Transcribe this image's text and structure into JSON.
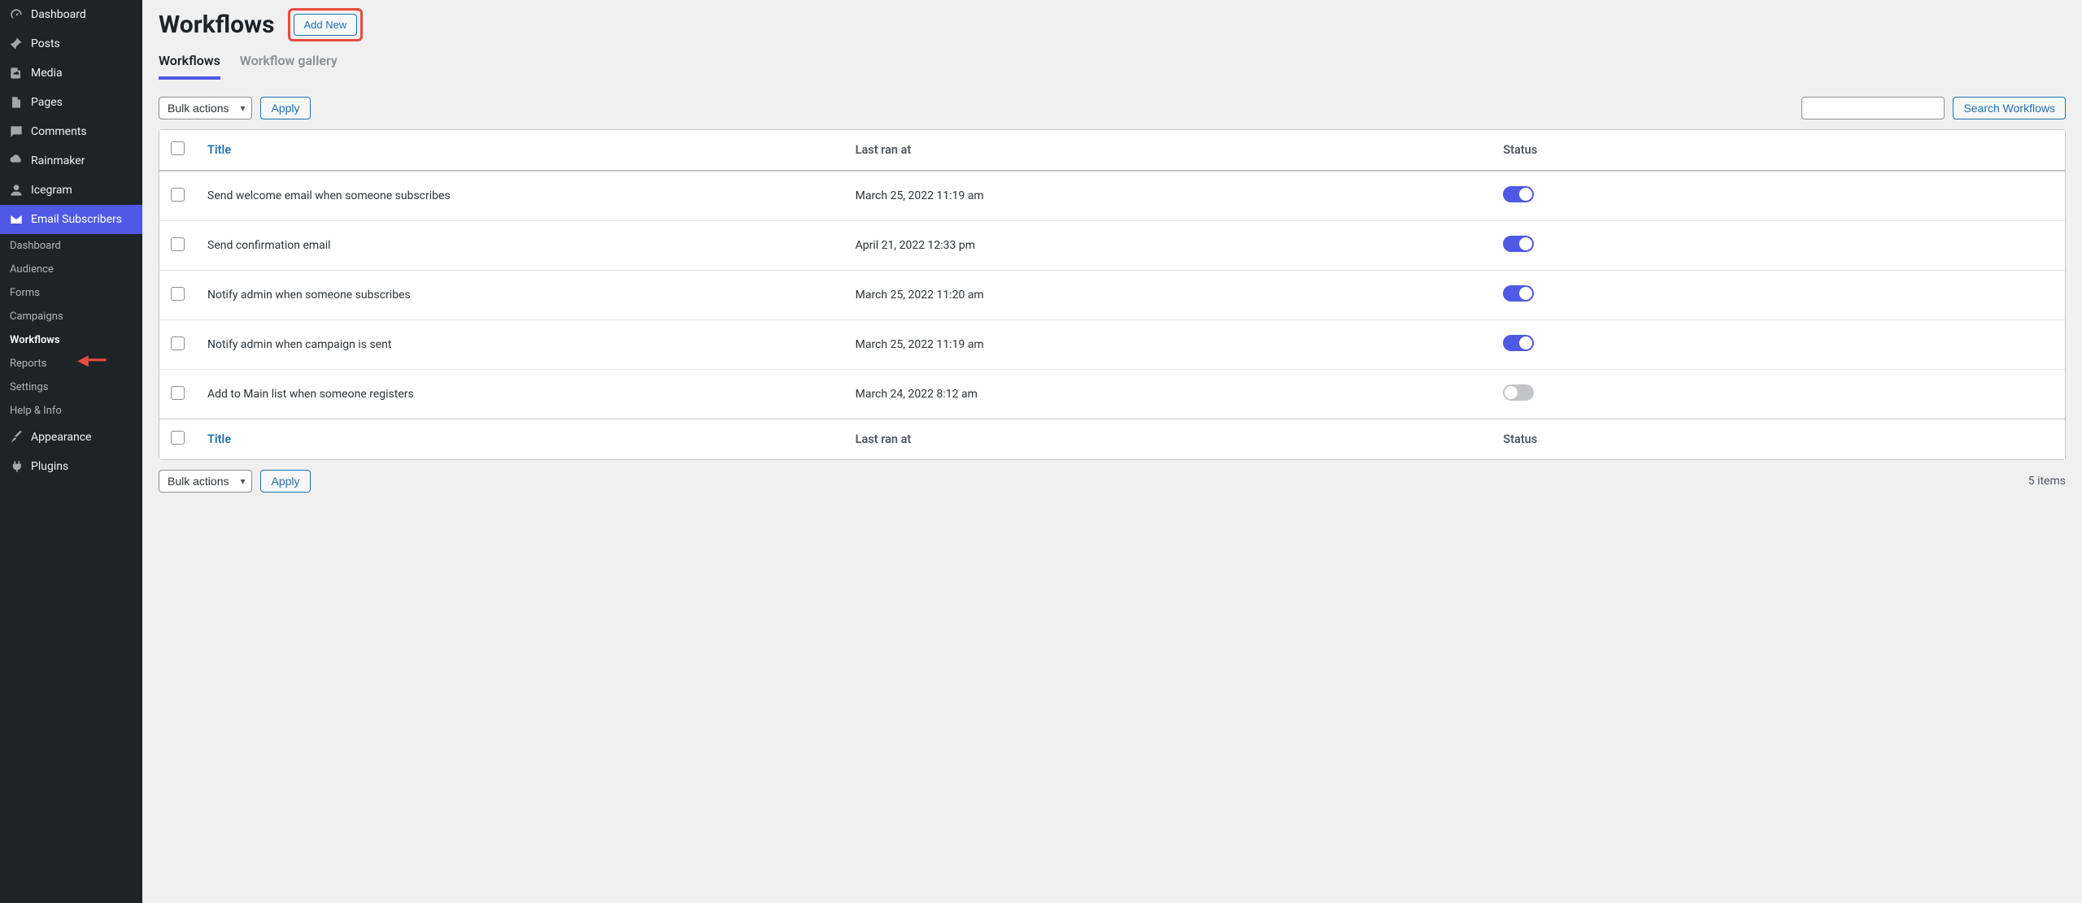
{
  "sidebar": {
    "items": [
      {
        "label": "Dashboard",
        "icon": "gauge"
      },
      {
        "label": "Posts",
        "icon": "pin"
      },
      {
        "label": "Media",
        "icon": "media"
      },
      {
        "label": "Pages",
        "icon": "page"
      },
      {
        "label": "Comments",
        "icon": "comment"
      },
      {
        "label": "Rainmaker",
        "icon": "cloud"
      },
      {
        "label": "Icegram",
        "icon": "user"
      },
      {
        "label": "Email Subscribers",
        "icon": "mail"
      },
      {
        "label": "Appearance",
        "icon": "brush"
      },
      {
        "label": "Plugins",
        "icon": "plug"
      }
    ],
    "sub_items": [
      {
        "label": "Dashboard"
      },
      {
        "label": "Audience"
      },
      {
        "label": "Forms"
      },
      {
        "label": "Campaigns"
      },
      {
        "label": "Workflows"
      },
      {
        "label": "Reports"
      },
      {
        "label": "Settings"
      },
      {
        "label": "Help & Info"
      }
    ]
  },
  "page": {
    "title": "Workflows",
    "add_new": "Add New",
    "tabs": [
      {
        "label": "Workflows"
      },
      {
        "label": "Workflow gallery"
      }
    ],
    "bulk_actions": "Bulk actions",
    "apply": "Apply",
    "search_btn": "Search Workflows",
    "items_count": "5 items",
    "columns": {
      "title": "Title",
      "last_ran": "Last ran at",
      "status": "Status"
    },
    "rows": [
      {
        "title": "Send welcome email when someone subscribes",
        "date": "March 25, 2022 11:19 am",
        "on": true
      },
      {
        "title": "Send confirmation email",
        "date": "April 21, 2022 12:33 pm",
        "on": true
      },
      {
        "title": "Notify admin when someone subscribes",
        "date": "March 25, 2022 11:20 am",
        "on": true
      },
      {
        "title": "Notify admin when campaign is sent",
        "date": "March 25, 2022 11:19 am",
        "on": true
      },
      {
        "title": "Add to Main list when someone registers",
        "date": "March 24, 2022 8:12 am",
        "on": false
      }
    ]
  }
}
